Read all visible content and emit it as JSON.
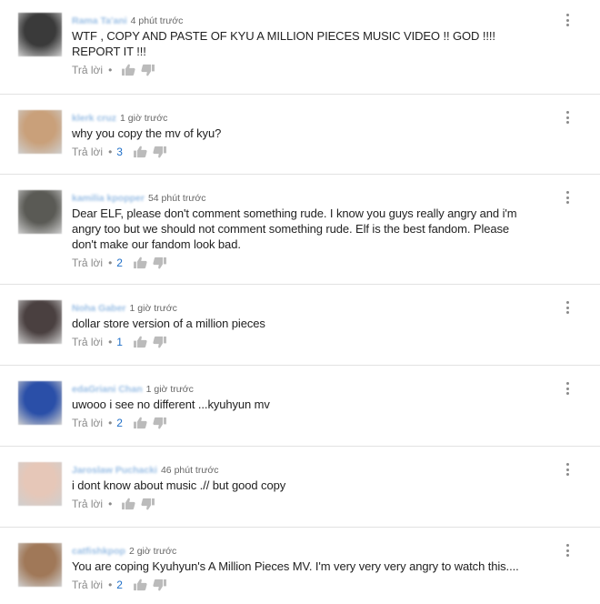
{
  "reply_label": "Trả lời",
  "comments": [
    {
      "author": "Rama Ta'ani",
      "time": "4 phút trước",
      "text": "WTF , COPY AND PASTE OF KYU A MILLION PIECES MUSIC VIDEO !! GOD !!!!\nREPORT IT !!!",
      "likes": "",
      "avatar_color": "#3a3a3a"
    },
    {
      "author": "klerk cruz",
      "time": "1 giờ trước",
      "text": "why you copy the mv of kyu?",
      "likes": "3",
      "avatar_color": "#c9a07a"
    },
    {
      "author": "kamilia kpopper",
      "time": "54 phút trước",
      "text": "Dear ELF, please don't comment something rude. I know you guys really angry and i'm\nangry too but we should not comment something rude. Elf is the best fandom. Please\ndon't make our fandom look bad.",
      "likes": "2",
      "avatar_color": "#5a5a55"
    },
    {
      "author": "Noha Gaber",
      "time": "1 giờ trước",
      "text": "dollar store version of a million pieces",
      "likes": "1",
      "avatar_color": "#4a4040"
    },
    {
      "author": "edaGriani Chan",
      "time": "1 giờ trước",
      "text": "uwooo i see no different ...kyuhyun mv",
      "likes": "2",
      "avatar_color": "#2a4fa8"
    },
    {
      "author": "Jaroslaw Puchacki",
      "time": "46 phút trước",
      "text": "i dont know about music .// but good copy",
      "likes": "",
      "avatar_color": "#e6c7b8"
    },
    {
      "author": "catfishkpop",
      "time": "2 giờ trước",
      "text": "You are coping Kyuhyun's A Million Pieces MV. I'm very very very angry to watch this....",
      "likes": "2",
      "avatar_color": "#a07858"
    }
  ]
}
